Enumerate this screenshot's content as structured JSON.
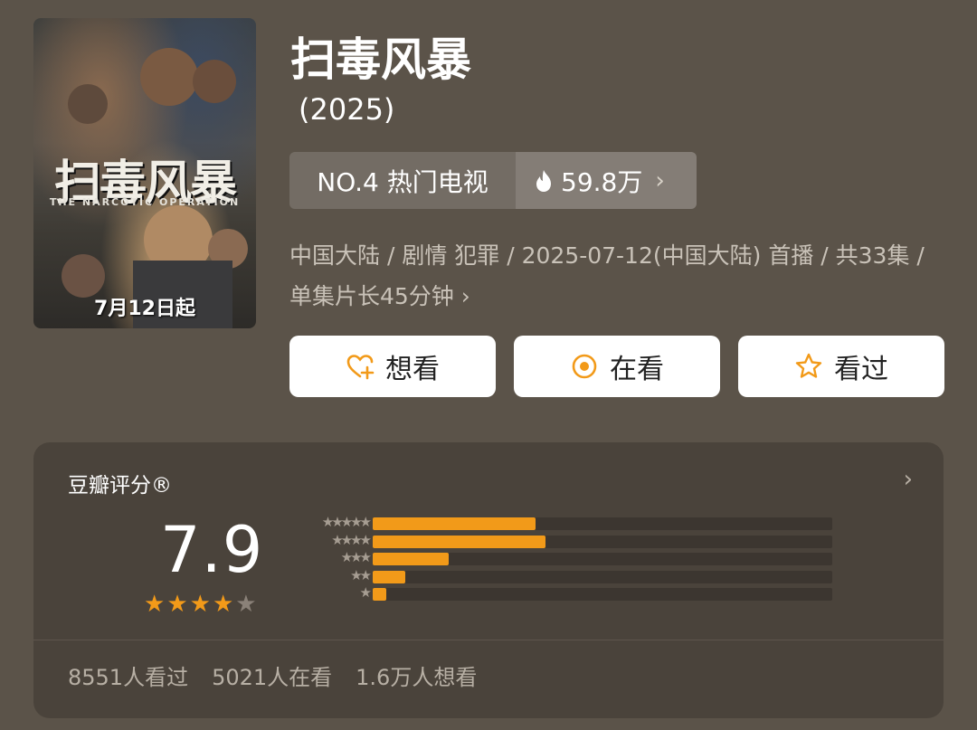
{
  "poster": {
    "title": "扫毒风暴",
    "subtitle": "THE NARCOTIC OPERATION",
    "date": "7月12日起"
  },
  "show": {
    "title": "扫毒风暴",
    "year": "(2025)"
  },
  "rank": {
    "label": "NO.4 热门电视",
    "heat": "59.8万",
    "heat_icon": "fire-icon"
  },
  "info": {
    "text": "中国大陆 / 剧情 犯罪 / 2025-07-12(中国大陆) 首播 / 共33集 / 单集片长45分钟"
  },
  "actions": [
    {
      "label": "想看",
      "icon": "heart-plus-icon"
    },
    {
      "label": "在看",
      "icon": "target-icon"
    },
    {
      "label": "看过",
      "icon": "star-icon"
    }
  ],
  "rating": {
    "title": "豆瓣评分®",
    "score": "7.9",
    "stars_filled": 4,
    "stars_total": 5,
    "distribution": [
      {
        "stars": 5,
        "label": "★★★★★",
        "percent": 35.5
      },
      {
        "stars": 4,
        "label": "★★★★",
        "percent": 37.5
      },
      {
        "stars": 3,
        "label": "★★★",
        "percent": 16.5
      },
      {
        "stars": 2,
        "label": "★★",
        "percent": 7
      },
      {
        "stars": 1,
        "label": "★",
        "percent": 3
      }
    ],
    "stats": [
      "8551人看过",
      "5021人在看",
      "1.6万人想看"
    ]
  },
  "colors": {
    "background": "#5b5349",
    "card": "#4a433b",
    "accent": "#f29a19"
  }
}
